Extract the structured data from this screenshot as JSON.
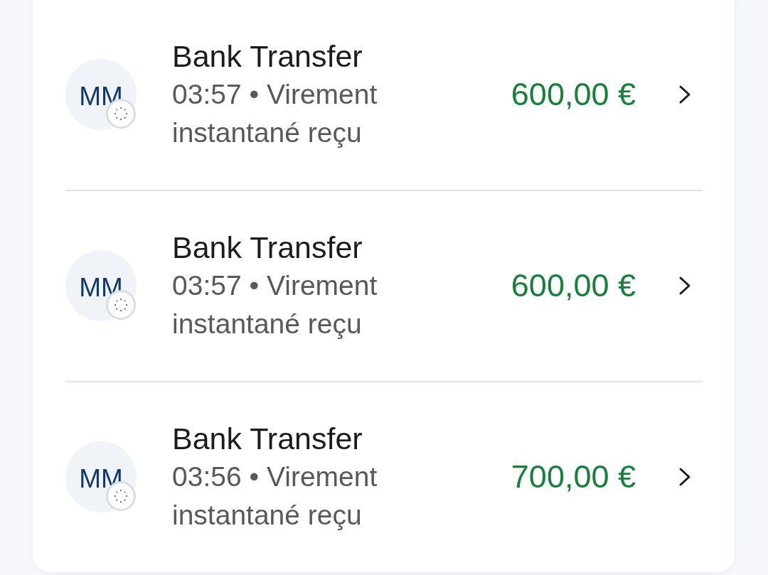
{
  "transactions": [
    {
      "initials": "MM",
      "title": "Bank Transfer",
      "subtitle": "03:57 • Virement instantané reçu",
      "amount": "600,00 €"
    },
    {
      "initials": "MM",
      "title": "Bank Transfer",
      "subtitle": "03:57 • Virement instantané reçu",
      "amount": "600,00 €"
    },
    {
      "initials": "MM",
      "title": "Bank Transfer",
      "subtitle": "03:56 • Virement instantané reçu",
      "amount": "700,00 €"
    }
  ]
}
